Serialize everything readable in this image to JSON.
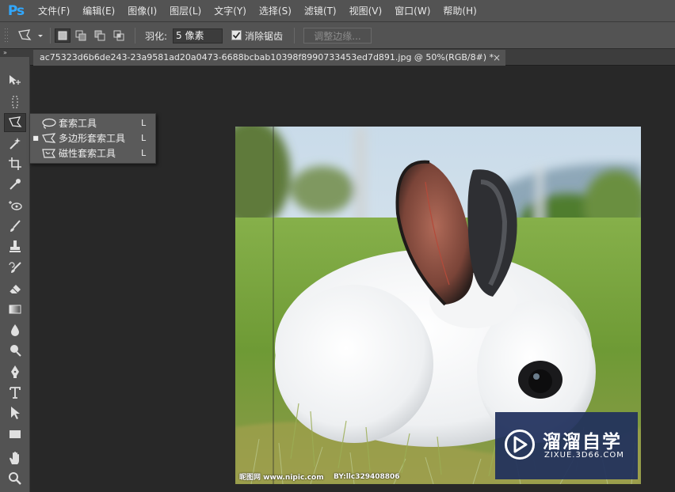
{
  "app": {
    "logo": "Ps"
  },
  "menu": [
    "文件(F)",
    "编辑(E)",
    "图像(I)",
    "图层(L)",
    "文字(Y)",
    "选择(S)",
    "滤镜(T)",
    "视图(V)",
    "窗口(W)",
    "帮助(H)"
  ],
  "options": {
    "feather_label": "羽化:",
    "feather_value": "5 像素",
    "antialias_label": "消除锯齿",
    "antialias_checked": true,
    "refine_edge_label": "调整边缘..."
  },
  "document": {
    "tab_title": "ac75323d6b6de243-23a9581ad20a0473-6688bcbab10398f8990733453ed7d891.jpg @ 50%(RGB/8#) *",
    "close_glyph": "×"
  },
  "flyout": [
    {
      "label": "套索工具",
      "key": "L",
      "active": false,
      "icon": "lasso-icon"
    },
    {
      "label": "多边形套索工具",
      "key": "L",
      "active": true,
      "icon": "polygonal-lasso-icon"
    },
    {
      "label": "磁性套索工具",
      "key": "L",
      "active": false,
      "icon": "magnetic-lasso-icon"
    }
  ],
  "watermarks": {
    "nipic": "昵图网 www.nipic.com",
    "id": "BY:llc329408806",
    "brand": "溜溜自学",
    "brand_url": "ZIXUE.3D66.COM"
  },
  "colors": {
    "accent": "#31a8ff",
    "ui_bg": "#535353",
    "workspace": "#282828"
  }
}
